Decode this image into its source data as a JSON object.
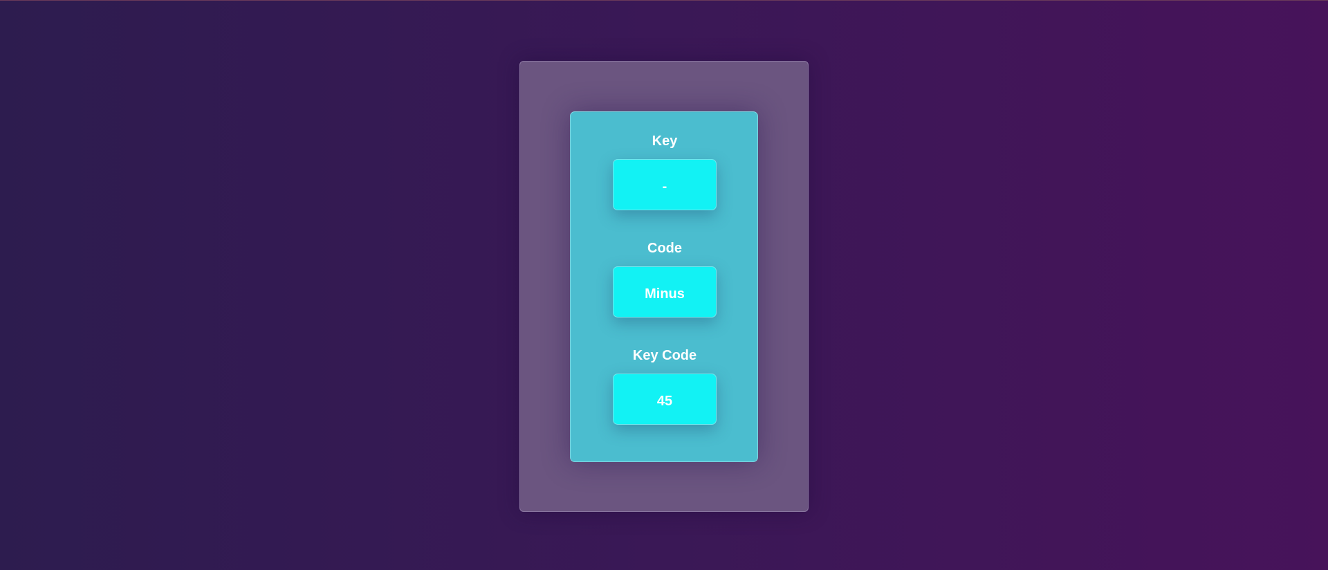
{
  "fields": {
    "key": {
      "label": "Key",
      "value": "-"
    },
    "code": {
      "label": "Code",
      "value": "Minus"
    },
    "key_code": {
      "label": "Key Code",
      "value": "45"
    }
  },
  "colors": {
    "background_start": "#2d1c4f",
    "background_end": "#47135a",
    "outer_panel": "#6b5580",
    "inner_panel": "#4bbdcf",
    "value_box": "#12f2f4",
    "text": "#ffffff"
  }
}
